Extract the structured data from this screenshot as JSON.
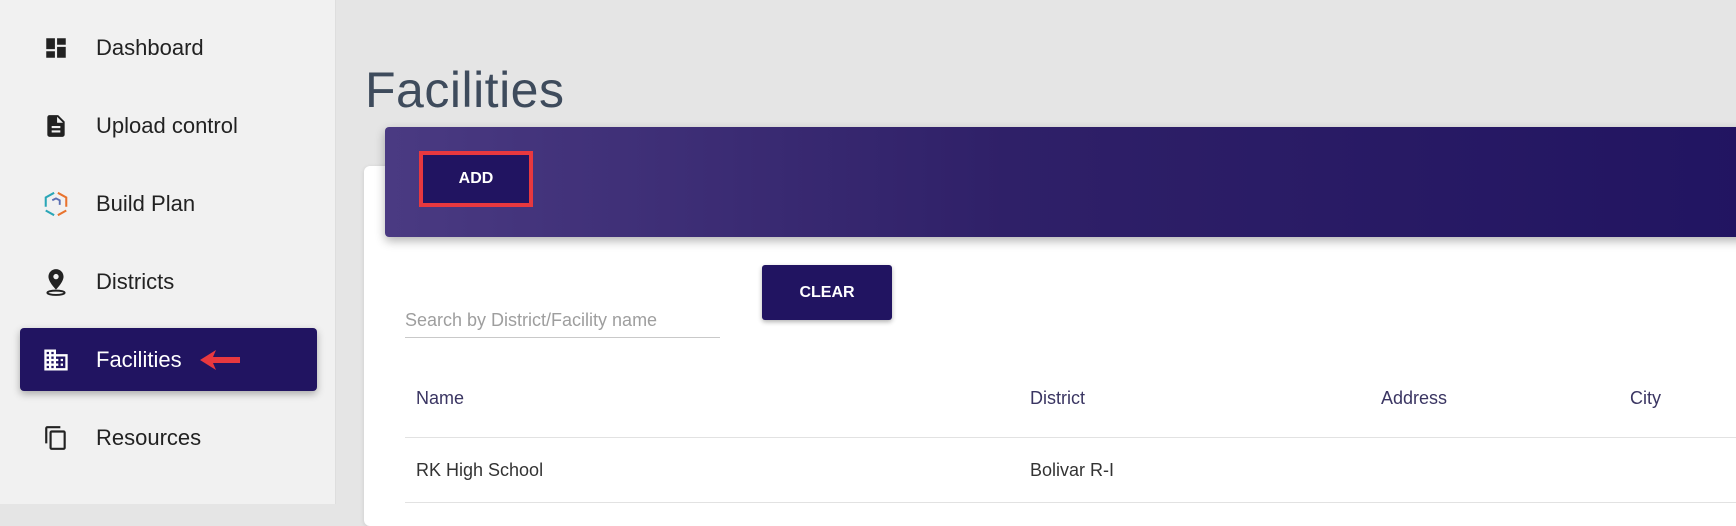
{
  "sidebar": {
    "items": [
      {
        "label": "Dashboard",
        "icon": "dashboard-icon"
      },
      {
        "label": "Upload control",
        "icon": "file-icon"
      },
      {
        "label": "Build Plan",
        "icon": "build-plan-logo-icon"
      },
      {
        "label": "Districts",
        "icon": "location-pin-icon"
      },
      {
        "label": "Facilities",
        "icon": "building-icon",
        "active": true
      },
      {
        "label": "Resources",
        "icon": "copy-icon"
      }
    ]
  },
  "main": {
    "title": "Facilities",
    "add_label": "ADD",
    "search": {
      "placeholder": "Search by District/Facility name",
      "value": ""
    },
    "clear_label": "CLEAR",
    "table": {
      "columns": [
        "Name",
        "District",
        "Address",
        "City"
      ],
      "rows": [
        [
          "RK High School",
          "Bolivar R-I",
          "",
          ""
        ]
      ]
    }
  },
  "colors": {
    "accent": "#211461",
    "highlight": "#e8383f"
  }
}
